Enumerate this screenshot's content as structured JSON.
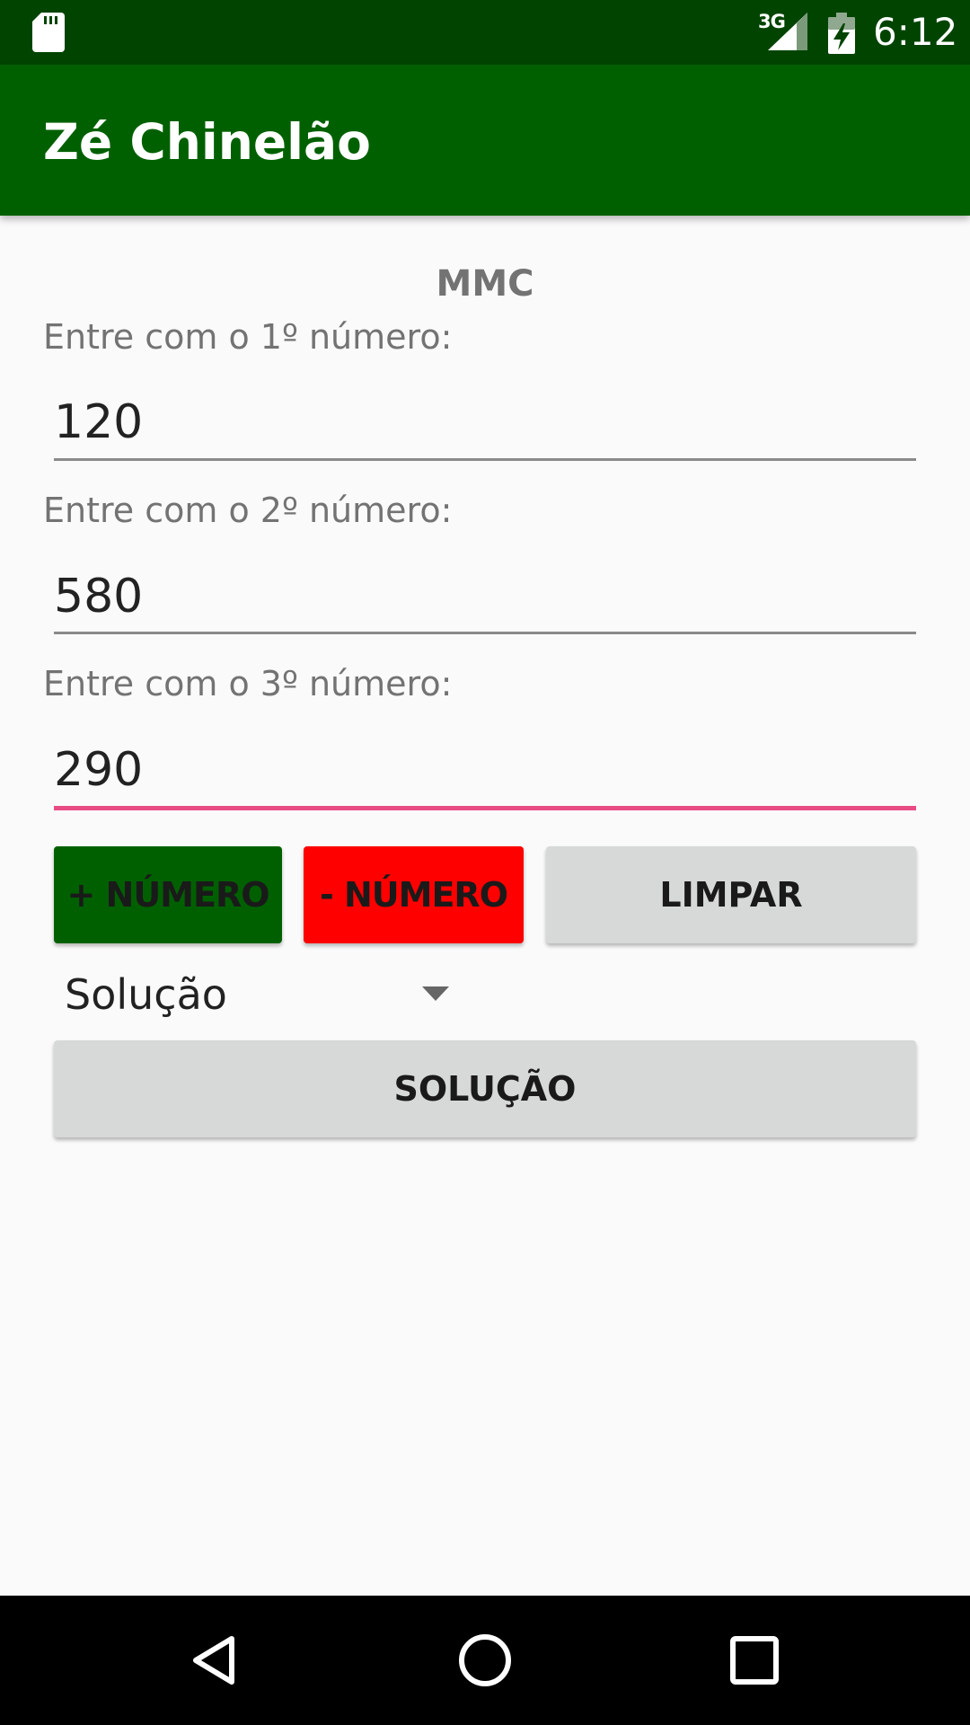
{
  "status_bar": {
    "time": "6:12",
    "network": "3G",
    "icons": [
      "sd-card-icon",
      "signal-icon",
      "battery-charging-icon"
    ]
  },
  "app_bar": {
    "title": "Zé Chinelão",
    "color": "#006000"
  },
  "main": {
    "section_title": "MMC",
    "fields": [
      {
        "label": "Entre com o 1º número:",
        "value": "120"
      },
      {
        "label": "Entre com o 2º número:",
        "value": "580"
      },
      {
        "label": "Entre com o 3º número:",
        "value": "290"
      }
    ],
    "buttons": {
      "add_number": "+ NÚMERO",
      "remove_number": "- NÚMERO",
      "clear": "LIMPAR",
      "solve": "SOLUÇÃO"
    },
    "spinner": {
      "selected": "Solução"
    }
  },
  "colors": {
    "add_button": "#006000",
    "remove_button": "#ff0000",
    "focus_accent": "#e94b85",
    "status_bar": "#004400"
  },
  "nav_bar": {
    "icons": [
      "back-icon",
      "home-icon",
      "recents-icon"
    ]
  }
}
